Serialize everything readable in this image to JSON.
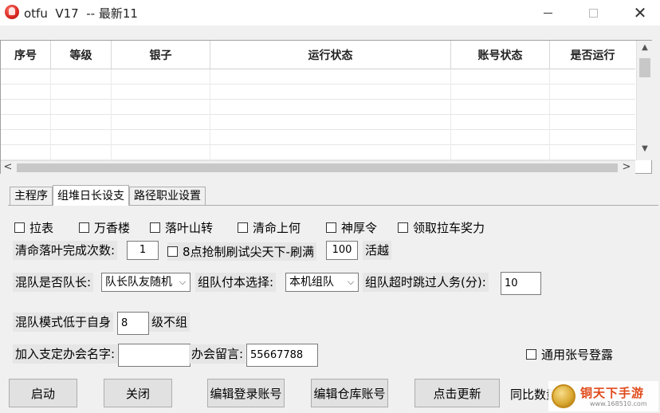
{
  "window": {
    "title": "otfu  V17  -- 最新11",
    "minimize_icon": "minimize-icon",
    "maximize_icon": "maximize-icon",
    "close_glyph": "✕"
  },
  "grid": {
    "columns": [
      "序号",
      "等级",
      "银子",
      "运行状态",
      "账号状态",
      "是否运行"
    ],
    "row_count": 6,
    "scroll_up": "▲",
    "scroll_down": "▼",
    "scroll_left": "<",
    "scroll_right": ">"
  },
  "tabs": [
    "主程序",
    "组堆日长设支",
    "路径职业设置"
  ],
  "active_tab": 1,
  "options": {
    "cb1": "拉表",
    "cb2": "万香楼",
    "cb3": "落叶山转",
    "cb4": "清命上何",
    "cb5": "神厚令",
    "cb6": "领取拉车奖力",
    "complete_label": "清命落叶完成次数:",
    "complete_value": "1",
    "grab_label": "8点抢制刷试尖天下-刷满",
    "grab_value": "100",
    "grab_suffix": "活越",
    "leader_label": "混队是否队长:",
    "leader_value": "队长队友随机",
    "copy_label": "组队付本选择:",
    "copy_value": "本机组队",
    "timeout_label": "组队超时跳过人务(分):",
    "timeout_value": "10",
    "mode_label": "混队模式低于自身",
    "mode_value": "8",
    "mode_suffix": "级不组",
    "guild_label": "加入支定办会名字:",
    "guild_value": "",
    "message_label": "办会留言:",
    "message_value": "55667788",
    "common_label": "通用张号登露"
  },
  "buttons": {
    "start": "启动",
    "close": "关闭",
    "edit_login": "编辑登录账号",
    "edit_storage": "编辑仓库账号",
    "update": "点击更新"
  },
  "footer_text": "同比数量",
  "watermark": {
    "text": "铜天下手游",
    "url": "www.168510.com"
  }
}
